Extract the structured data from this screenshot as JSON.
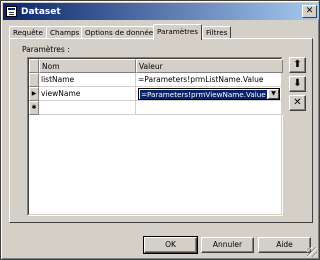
{
  "window": {
    "title": "Dataset"
  },
  "tabs": [
    {
      "label": "Requête"
    },
    {
      "label": "Champs"
    },
    {
      "label": "Options de données"
    },
    {
      "label": "Paramètres"
    },
    {
      "label": "Filtres"
    }
  ],
  "active_tab": "Paramètres",
  "section_label": "Paramètres :",
  "grid": {
    "columns": [
      "Nom",
      "Valeur"
    ],
    "rows": [
      {
        "name": "listName",
        "value": "=Parameters!prmListName.Value"
      },
      {
        "name": "viewName",
        "value": "=Parameters!prmViewName.Value",
        "editing": true
      }
    ],
    "current_row_marker": "▶",
    "new_row_marker": "✱"
  },
  "side_buttons": {
    "move_up": "⬆",
    "move_down": "⬇",
    "delete": "✕"
  },
  "buttons": {
    "ok": "OK",
    "cancel": "Annuler",
    "help": "Aide"
  },
  "colors": {
    "titlebar_start": "#0a246a",
    "titlebar_end": "#a6caf0",
    "face": "#d4d0c8",
    "selection": "#0a246a"
  }
}
